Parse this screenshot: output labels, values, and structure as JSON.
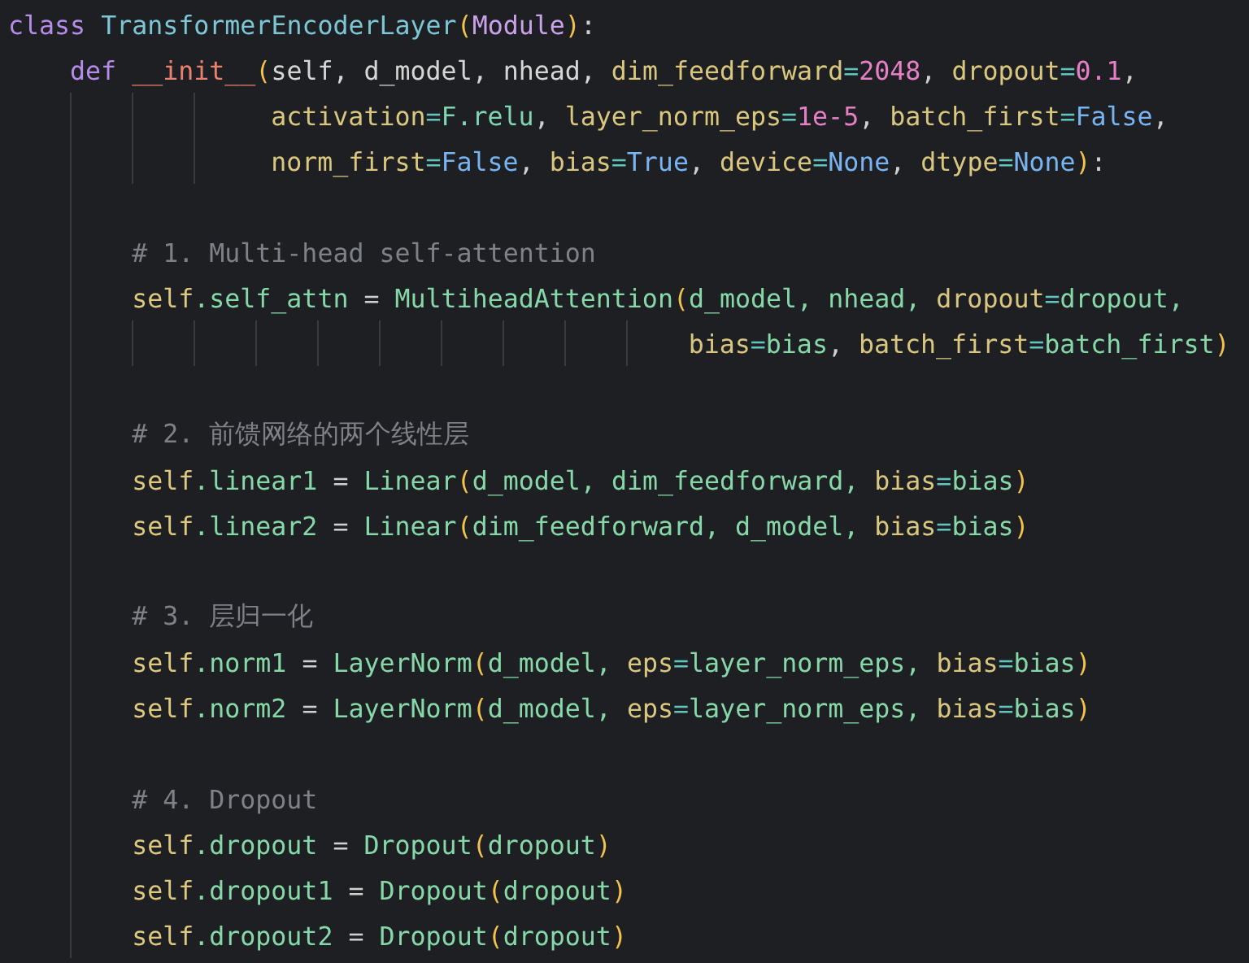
{
  "editor": {
    "lines": [
      {
        "kind": "code",
        "tokens": [
          {
            "kind": "keyword",
            "text": "class "
          },
          {
            "kind": "class",
            "text": "TransformerEncoderLayer"
          },
          {
            "kind": "paren",
            "text": "("
          },
          {
            "kind": "builtin",
            "text": "Module"
          },
          {
            "kind": "paren",
            "text": ")"
          },
          {
            "kind": "punct",
            "text": ":"
          }
        ],
        "children": [
          {
            "kind": "code",
            "tokens": [
              {
                "kind": "keyword",
                "text": "def "
              },
              {
                "kind": "function",
                "text": "__init__"
              },
              {
                "kind": "paren",
                "text": "("
              },
              {
                "kind": "param",
                "text": "self, d_model, nhead, "
              },
              {
                "kind": "kwarg",
                "text": "dim_feedforward"
              },
              {
                "kind": "op",
                "text": "="
              },
              {
                "kind": "number",
                "text": "2048"
              },
              {
                "kind": "punct",
                "text": ", "
              },
              {
                "kind": "kwarg",
                "text": "dropout"
              },
              {
                "kind": "op",
                "text": "="
              },
              {
                "kind": "number",
                "text": "0.1"
              },
              {
                "kind": "punct",
                "text": ","
              }
            ],
            "continuation": [
              {
                "kind": "code",
                "tokens": [
                  {
                    "kind": "kwarg",
                    "text": "activation"
                  },
                  {
                    "kind": "op",
                    "text": "="
                  },
                  {
                    "kind": "ident",
                    "text": "F.relu"
                  },
                  {
                    "kind": "punct",
                    "text": ", "
                  },
                  {
                    "kind": "kwarg",
                    "text": "layer_norm_eps"
                  },
                  {
                    "kind": "op",
                    "text": "="
                  },
                  {
                    "kind": "number",
                    "text": "1e-5"
                  },
                  {
                    "kind": "punct",
                    "text": ", "
                  },
                  {
                    "kind": "kwarg",
                    "text": "batch_first"
                  },
                  {
                    "kind": "op",
                    "text": "="
                  },
                  {
                    "kind": "constant",
                    "text": "False"
                  },
                  {
                    "kind": "punct",
                    "text": ","
                  }
                ]
              },
              {
                "kind": "code",
                "tokens": [
                  {
                    "kind": "kwarg",
                    "text": "norm_first"
                  },
                  {
                    "kind": "op",
                    "text": "="
                  },
                  {
                    "kind": "constant",
                    "text": "False"
                  },
                  {
                    "kind": "punct",
                    "text": ", "
                  },
                  {
                    "kind": "kwarg",
                    "text": "bias"
                  },
                  {
                    "kind": "op",
                    "text": "="
                  },
                  {
                    "kind": "constant",
                    "text": "True"
                  },
                  {
                    "kind": "punct",
                    "text": ", "
                  },
                  {
                    "kind": "kwarg",
                    "text": "device"
                  },
                  {
                    "kind": "op",
                    "text": "="
                  },
                  {
                    "kind": "constant",
                    "text": "None"
                  },
                  {
                    "kind": "punct",
                    "text": ", "
                  },
                  {
                    "kind": "kwarg",
                    "text": "dtype"
                  },
                  {
                    "kind": "op",
                    "text": "="
                  },
                  {
                    "kind": "constant",
                    "text": "None"
                  },
                  {
                    "kind": "paren",
                    "text": ")"
                  },
                  {
                    "kind": "punct",
                    "text": ":"
                  }
                ]
              }
            ],
            "children": [
              {
                "kind": "blank"
              },
              {
                "kind": "code",
                "tokens": [
                  {
                    "kind": "comment",
                    "text": "# 1. Multi-head self-attention"
                  }
                ]
              },
              {
                "kind": "code",
                "tokens": [
                  {
                    "kind": "self",
                    "text": "self"
                  },
                  {
                    "kind": "member",
                    "text": ".self_attn"
                  },
                  {
                    "kind": "assign",
                    "text": " = "
                  },
                  {
                    "kind": "member",
                    "text": "MultiheadAttention"
                  },
                  {
                    "kind": "paren",
                    "text": "("
                  },
                  {
                    "kind": "member",
                    "text": "d_model, nhead, "
                  },
                  {
                    "kind": "kwarg",
                    "text": "dropout"
                  },
                  {
                    "kind": "op",
                    "text": "="
                  },
                  {
                    "kind": "member",
                    "text": "dropout,"
                  }
                ],
                "continuation": [
                  {
                    "kind": "code",
                    "tokens": [
                      {
                        "kind": "kwarg",
                        "text": "bias"
                      },
                      {
                        "kind": "op",
                        "text": "="
                      },
                      {
                        "kind": "member",
                        "text": "bias"
                      },
                      {
                        "kind": "punct",
                        "text": ", "
                      },
                      {
                        "kind": "kwarg",
                        "text": "batch_first"
                      },
                      {
                        "kind": "op",
                        "text": "="
                      },
                      {
                        "kind": "member",
                        "text": "batch_first"
                      },
                      {
                        "kind": "paren",
                        "text": ")"
                      }
                    ]
                  }
                ]
              },
              {
                "kind": "blank"
              },
              {
                "kind": "code",
                "tokens": [
                  {
                    "kind": "comment",
                    "text": "# 2. 前馈网络的两个线性层"
                  }
                ]
              },
              {
                "kind": "code",
                "tokens": [
                  {
                    "kind": "self",
                    "text": "self"
                  },
                  {
                    "kind": "member",
                    "text": ".linear1"
                  },
                  {
                    "kind": "assign",
                    "text": " = "
                  },
                  {
                    "kind": "member",
                    "text": "Linear"
                  },
                  {
                    "kind": "paren",
                    "text": "("
                  },
                  {
                    "kind": "member",
                    "text": "d_model, dim_feedforward, "
                  },
                  {
                    "kind": "kwarg",
                    "text": "bias"
                  },
                  {
                    "kind": "op",
                    "text": "="
                  },
                  {
                    "kind": "member",
                    "text": "bias"
                  },
                  {
                    "kind": "paren",
                    "text": ")"
                  }
                ]
              },
              {
                "kind": "code",
                "tokens": [
                  {
                    "kind": "self",
                    "text": "self"
                  },
                  {
                    "kind": "member",
                    "text": ".linear2"
                  },
                  {
                    "kind": "assign",
                    "text": " = "
                  },
                  {
                    "kind": "member",
                    "text": "Linear"
                  },
                  {
                    "kind": "paren",
                    "text": "("
                  },
                  {
                    "kind": "member",
                    "text": "dim_feedforward, d_model, "
                  },
                  {
                    "kind": "kwarg",
                    "text": "bias"
                  },
                  {
                    "kind": "op",
                    "text": "="
                  },
                  {
                    "kind": "member",
                    "text": "bias"
                  },
                  {
                    "kind": "paren",
                    "text": ")"
                  }
                ]
              },
              {
                "kind": "blank"
              },
              {
                "kind": "code",
                "tokens": [
                  {
                    "kind": "comment",
                    "text": "# 3. 层归一化"
                  }
                ]
              },
              {
                "kind": "code",
                "tokens": [
                  {
                    "kind": "self",
                    "text": "self"
                  },
                  {
                    "kind": "member",
                    "text": ".norm1"
                  },
                  {
                    "kind": "assign",
                    "text": " = "
                  },
                  {
                    "kind": "member",
                    "text": "LayerNorm"
                  },
                  {
                    "kind": "paren",
                    "text": "("
                  },
                  {
                    "kind": "member",
                    "text": "d_model, "
                  },
                  {
                    "kind": "kwarg",
                    "text": "eps"
                  },
                  {
                    "kind": "op",
                    "text": "="
                  },
                  {
                    "kind": "member",
                    "text": "layer_norm_eps, "
                  },
                  {
                    "kind": "kwarg",
                    "text": "bias"
                  },
                  {
                    "kind": "op",
                    "text": "="
                  },
                  {
                    "kind": "member",
                    "text": "bias"
                  },
                  {
                    "kind": "paren",
                    "text": ")"
                  }
                ]
              },
              {
                "kind": "code",
                "tokens": [
                  {
                    "kind": "self",
                    "text": "self"
                  },
                  {
                    "kind": "member",
                    "text": ".norm2"
                  },
                  {
                    "kind": "assign",
                    "text": " = "
                  },
                  {
                    "kind": "member",
                    "text": "LayerNorm"
                  },
                  {
                    "kind": "paren",
                    "text": "("
                  },
                  {
                    "kind": "member",
                    "text": "d_model, "
                  },
                  {
                    "kind": "kwarg",
                    "text": "eps"
                  },
                  {
                    "kind": "op",
                    "text": "="
                  },
                  {
                    "kind": "member",
                    "text": "layer_norm_eps, "
                  },
                  {
                    "kind": "kwarg",
                    "text": "bias"
                  },
                  {
                    "kind": "op",
                    "text": "="
                  },
                  {
                    "kind": "member",
                    "text": "bias"
                  },
                  {
                    "kind": "paren",
                    "text": ")"
                  }
                ]
              },
              {
                "kind": "blank"
              },
              {
                "kind": "code",
                "tokens": [
                  {
                    "kind": "comment",
                    "text": "# 4. Dropout"
                  }
                ]
              },
              {
                "kind": "code",
                "tokens": [
                  {
                    "kind": "self",
                    "text": "self"
                  },
                  {
                    "kind": "member",
                    "text": ".dropout"
                  },
                  {
                    "kind": "assign",
                    "text": " = "
                  },
                  {
                    "kind": "member",
                    "text": "Dropout"
                  },
                  {
                    "kind": "paren",
                    "text": "("
                  },
                  {
                    "kind": "member",
                    "text": "dropout"
                  },
                  {
                    "kind": "paren",
                    "text": ")"
                  }
                ]
              },
              {
                "kind": "code",
                "tokens": [
                  {
                    "kind": "self",
                    "text": "self"
                  },
                  {
                    "kind": "member",
                    "text": ".dropout1"
                  },
                  {
                    "kind": "assign",
                    "text": " = "
                  },
                  {
                    "kind": "member",
                    "text": "Dropout"
                  },
                  {
                    "kind": "paren",
                    "text": "("
                  },
                  {
                    "kind": "member",
                    "text": "dropout"
                  },
                  {
                    "kind": "paren",
                    "text": ")"
                  }
                ]
              },
              {
                "kind": "code",
                "tokens": [
                  {
                    "kind": "self",
                    "text": "self"
                  },
                  {
                    "kind": "member",
                    "text": ".dropout2"
                  },
                  {
                    "kind": "assign",
                    "text": " = "
                  },
                  {
                    "kind": "member",
                    "text": "Dropout"
                  },
                  {
                    "kind": "paren",
                    "text": "("
                  },
                  {
                    "kind": "member",
                    "text": "dropout"
                  },
                  {
                    "kind": "paren",
                    "text": ")"
                  }
                ]
              }
            ]
          }
        ]
      }
    ]
  }
}
